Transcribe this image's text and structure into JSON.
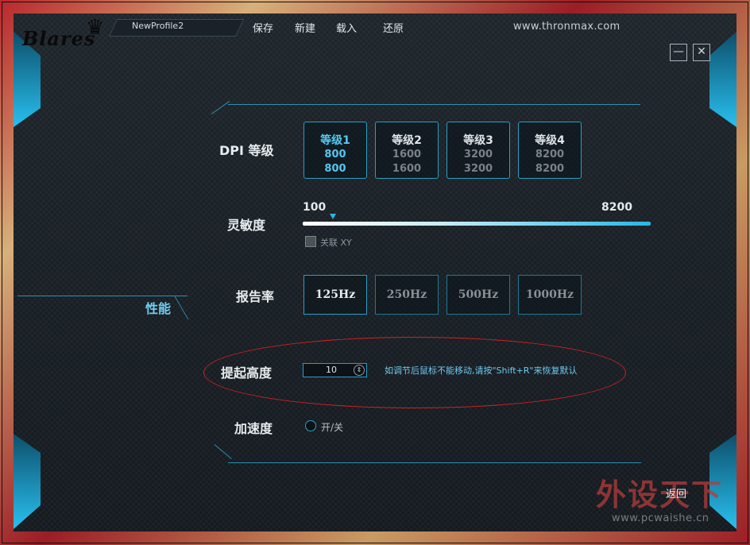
{
  "header": {
    "logo": "Blares",
    "profile_name": "NewProfile2",
    "menu": [
      "保存",
      "新建",
      "载入",
      "还原"
    ],
    "site_url": "www.thronmax.com",
    "minimize_glyph": "—",
    "close_glyph": "✕"
  },
  "side": {
    "section_label": "性能"
  },
  "dpi": {
    "label": "DPI 等级",
    "levels": [
      {
        "title": "等级1",
        "x": "800",
        "y": "800",
        "active": true
      },
      {
        "title": "等级2",
        "x": "1600",
        "y": "1600",
        "active": false
      },
      {
        "title": "等级3",
        "x": "3200",
        "y": "3200",
        "active": false
      },
      {
        "title": "等级4",
        "x": "8200",
        "y": "8200",
        "active": false
      }
    ]
  },
  "sensitivity": {
    "label": "灵敏度",
    "min_label": "100",
    "max_label": "8200",
    "link_xy_label": "关联 XY"
  },
  "report_rate": {
    "label": "报告率",
    "options": [
      "125Hz",
      "250Hz",
      "500Hz",
      "1000Hz"
    ],
    "selected": "125Hz"
  },
  "lift_off": {
    "label": "提起高度",
    "value": "10",
    "hint": "如调节后鼠标不能移动,请按\"Shift+R\"来恢复默认"
  },
  "acceleration": {
    "label": "加速度",
    "toggle_label": "开/关"
  },
  "footer": {
    "back_label": "返回",
    "watermark": "外设天下",
    "watermark_url": "www.pcwaishe.cn"
  },
  "colors": {
    "accent": "#2ab6e8",
    "panel": "#1a2026",
    "highlight_circle": "#d82020"
  }
}
